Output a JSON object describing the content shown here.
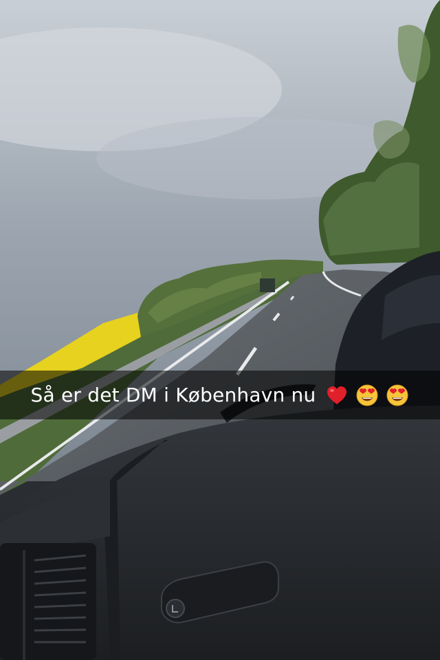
{
  "caption": {
    "text": "Så er det DM i København nu",
    "emojis": [
      "red-heart-icon",
      "heart-eyes-face-icon",
      "heart-eyes-face-icon"
    ]
  },
  "colors": {
    "sky": "#9aa3ad",
    "rapeseed": "#e6d21f",
    "road": "#5a5e63",
    "dashboard": "#24272b"
  }
}
